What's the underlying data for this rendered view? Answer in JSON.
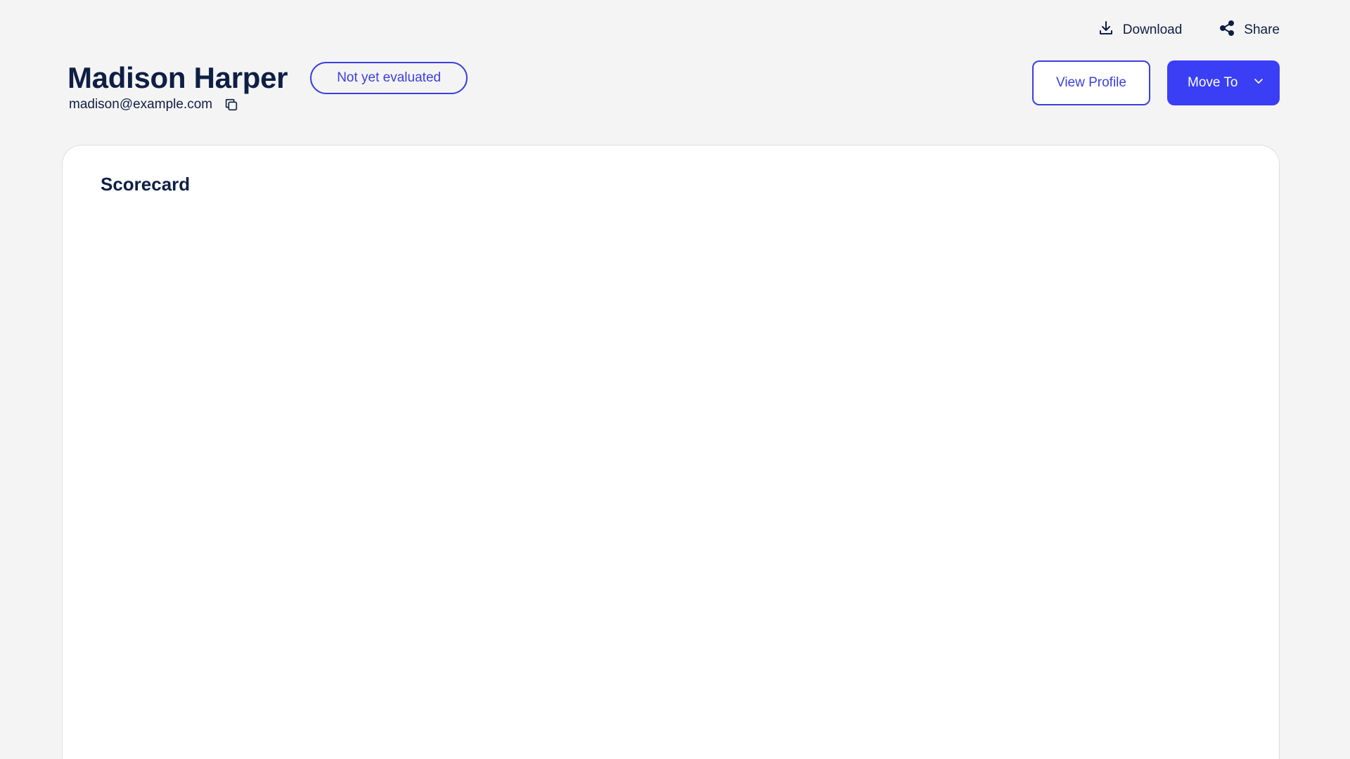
{
  "top_actions": {
    "download_label": "Download",
    "share_label": "Share"
  },
  "candidate": {
    "name": "Madison Harper",
    "status": "Not yet evaluated",
    "email": "madison@example.com"
  },
  "header_buttons": {
    "view_profile_label": "View Profile",
    "move_to_label": "Move To"
  },
  "card": {
    "title": "Scorecard"
  },
  "icons": {
    "download": "download-icon",
    "share": "share-icon",
    "copy": "copy-icon",
    "chevron": "chevron-down-icon"
  },
  "colors": {
    "accent": "#3a3ff5",
    "text": "#0e1f45",
    "background": "#f5f4f4"
  }
}
